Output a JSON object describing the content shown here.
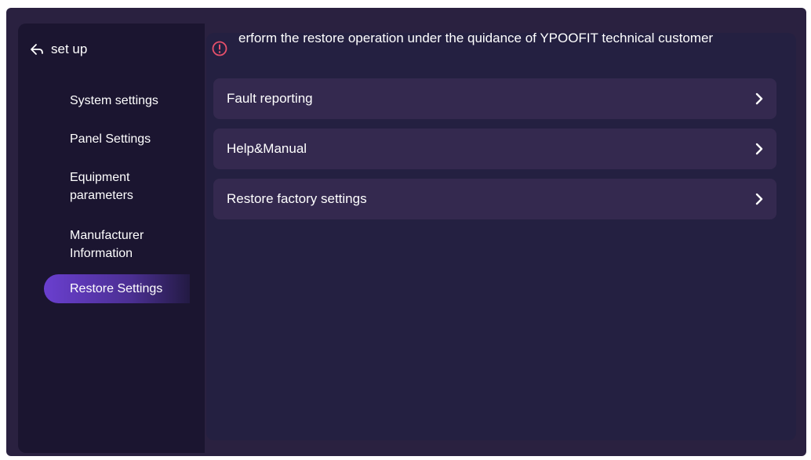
{
  "sidebar": {
    "back_label": "set up",
    "items": [
      {
        "label": "System settings"
      },
      {
        "label": "Panel Settings"
      },
      {
        "label": "Equipment parameters"
      },
      {
        "label": "Manufacturer Information"
      },
      {
        "label": "Restore Settings",
        "active": true
      }
    ]
  },
  "main": {
    "warning_text": "erform the restore operation under the quidance of YPOOFIT technical customer",
    "rows": [
      {
        "label": "Fault reporting",
        "icon": "chevron-right-icon"
      },
      {
        "label": "Help&Manual",
        "icon": "chevron-right-icon"
      },
      {
        "label": "Restore factory settings",
        "icon": "chevron-right-icon"
      }
    ]
  },
  "colors": {
    "warning_accent": "#e8506b",
    "active_item": "#6a3fcf"
  }
}
